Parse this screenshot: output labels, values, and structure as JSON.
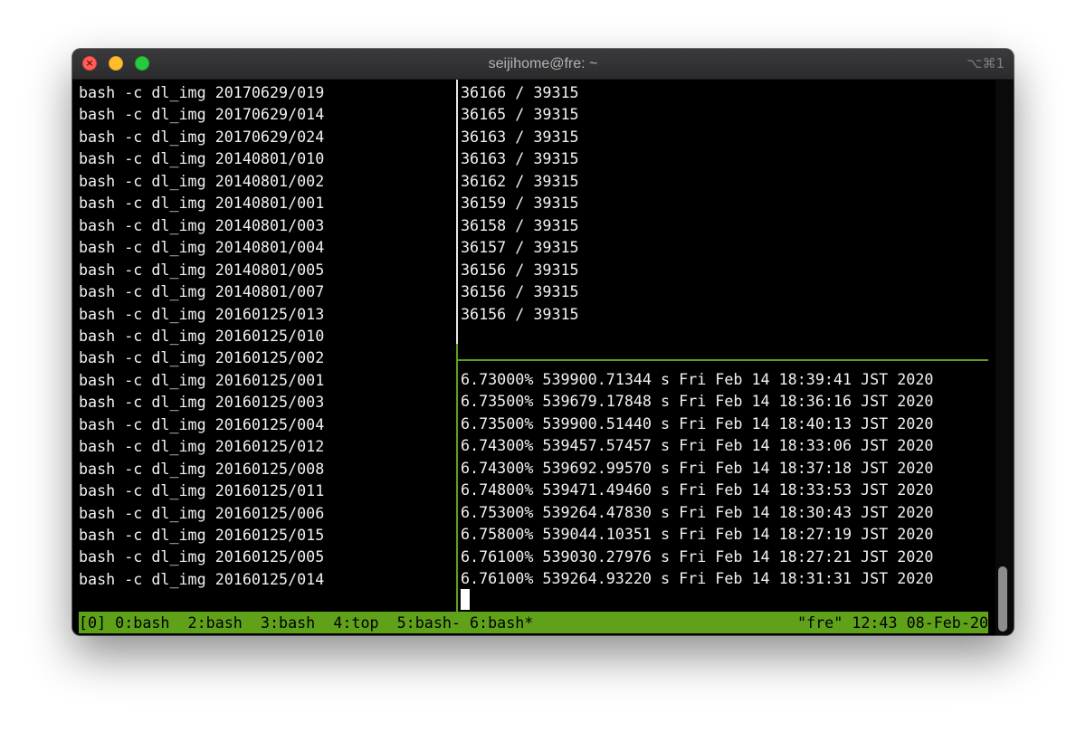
{
  "window": {
    "title": "seijihome@fre: ~",
    "shortcut": "⌥⌘1",
    "controls": {
      "close_glyph": "×"
    }
  },
  "left_pane": {
    "lines": [
      "bash -c dl_img 20170629/019",
      "bash -c dl_img 20170629/014",
      "bash -c dl_img 20170629/024",
      "bash -c dl_img 20140801/010",
      "bash -c dl_img 20140801/002",
      "bash -c dl_img 20140801/001",
      "bash -c dl_img 20140801/003",
      "bash -c dl_img 20140801/004",
      "bash -c dl_img 20140801/005",
      "bash -c dl_img 20140801/007",
      "bash -c dl_img 20160125/013",
      "bash -c dl_img 20160125/010",
      "bash -c dl_img 20160125/002",
      "bash -c dl_img 20160125/001",
      "bash -c dl_img 20160125/003",
      "bash -c dl_img 20160125/004",
      "bash -c dl_img 20160125/012",
      "bash -c dl_img 20160125/008",
      "bash -c dl_img 20160125/011",
      "bash -c dl_img 20160125/006",
      "bash -c dl_img 20160125/015",
      "bash -c dl_img 20160125/005",
      "bash -c dl_img 20160125/014"
    ]
  },
  "right_top_pane": {
    "lines": [
      "36166 / 39315",
      "36165 / 39315",
      "36163 / 39315",
      "36163 / 39315",
      "36162 / 39315",
      "36159 / 39315",
      "36158 / 39315",
      "36157 / 39315",
      "36156 / 39315",
      "36156 / 39315",
      "36156 / 39315"
    ]
  },
  "right_bottom_pane": {
    "lines": [
      "6.73000% 539900.71344 s Fri Feb 14 18:39:41 JST 2020",
      "6.73500% 539679.17848 s Fri Feb 14 18:36:16 JST 2020",
      "6.73500% 539900.51440 s Fri Feb 14 18:40:13 JST 2020",
      "6.74300% 539457.57457 s Fri Feb 14 18:33:06 JST 2020",
      "6.74300% 539692.99570 s Fri Feb 14 18:37:18 JST 2020",
      "6.74800% 539471.49460 s Fri Feb 14 18:33:53 JST 2020",
      "6.75300% 539264.47830 s Fri Feb 14 18:30:43 JST 2020",
      "6.75800% 539044.10351 s Fri Feb 14 18:27:19 JST 2020",
      "6.76100% 539030.27976 s Fri Feb 14 18:27:21 JST 2020",
      "6.76100% 539264.93220 s Fri Feb 14 18:31:31 JST 2020"
    ]
  },
  "statusbar": {
    "left": "[0] 0:bash  2:bash  3:bash  4:top  5:bash- 6:bash*",
    "right": "\"fre\" 12:43 08-Feb-20"
  },
  "colors": {
    "status_green": "#5fa21a",
    "pane_border_active": "#5f9f1f",
    "pane_border_inactive": "#e8e8e8",
    "terminal_bg": "#000000",
    "terminal_fg": "#f2f2f2"
  }
}
